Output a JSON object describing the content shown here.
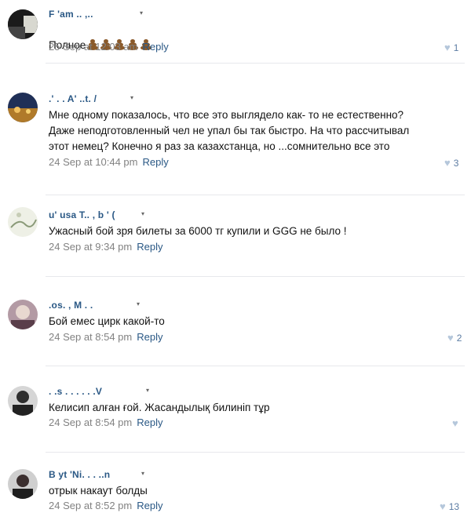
{
  "comments": [
    {
      "author": "F  'am .. ,..",
      "text": "Полное",
      "emoji_count": 5,
      "date": "25 Sep at 12:03 am",
      "reply": "Reply",
      "likes": "1",
      "avatar_color": "#1a1a1a"
    },
    {
      "author": ".' . .  A' ..t. /",
      "text": "Мне одному показалось, что все это выглядело как- то не естественно?\nДаже неподготовленный чел не упал бы так быстро. На что рассчитывал\nэтот немец? Конечно я раз за казахстанца, но ...сомнительно все это",
      "date": "24 Sep at 10:44 pm",
      "reply": "Reply",
      "likes": "3",
      "avatar_color": "#2d3f66"
    },
    {
      "author": "u' usa T.. ,  b ' (",
      "text": "Ужасный бой зря билеты за 6000 тг купили и GGG не было !",
      "date": "24 Sep at 9:34 pm",
      "reply": "Reply",
      "likes": "",
      "avatar_color": "#e9ecdf"
    },
    {
      "author": ".os. ,  M  . .",
      "text": "Бой емес цирк какой-то",
      "date": "24 Sep at 8:54 pm",
      "reply": "Reply",
      "likes": "2",
      "avatar_color": "#9a7f8a"
    },
    {
      "author": ". .s . . .  .  . .V",
      "text": "Келисип алған ғой. Жасандылық билиніп тұр",
      "date": "24 Sep at 8:54 pm",
      "reply": "Reply",
      "likes": "",
      "avatar_color": "#3a3a3a"
    },
    {
      "author": "B yt  'Ni. . . ..n",
      "text": "отрык накаут болды",
      "date": "24 Sep at 8:52 pm",
      "reply": "Reply",
      "likes": "13",
      "avatar_color": "#2f2a2a"
    }
  ],
  "caret_glyph": "▾",
  "heart_glyph": "♥"
}
